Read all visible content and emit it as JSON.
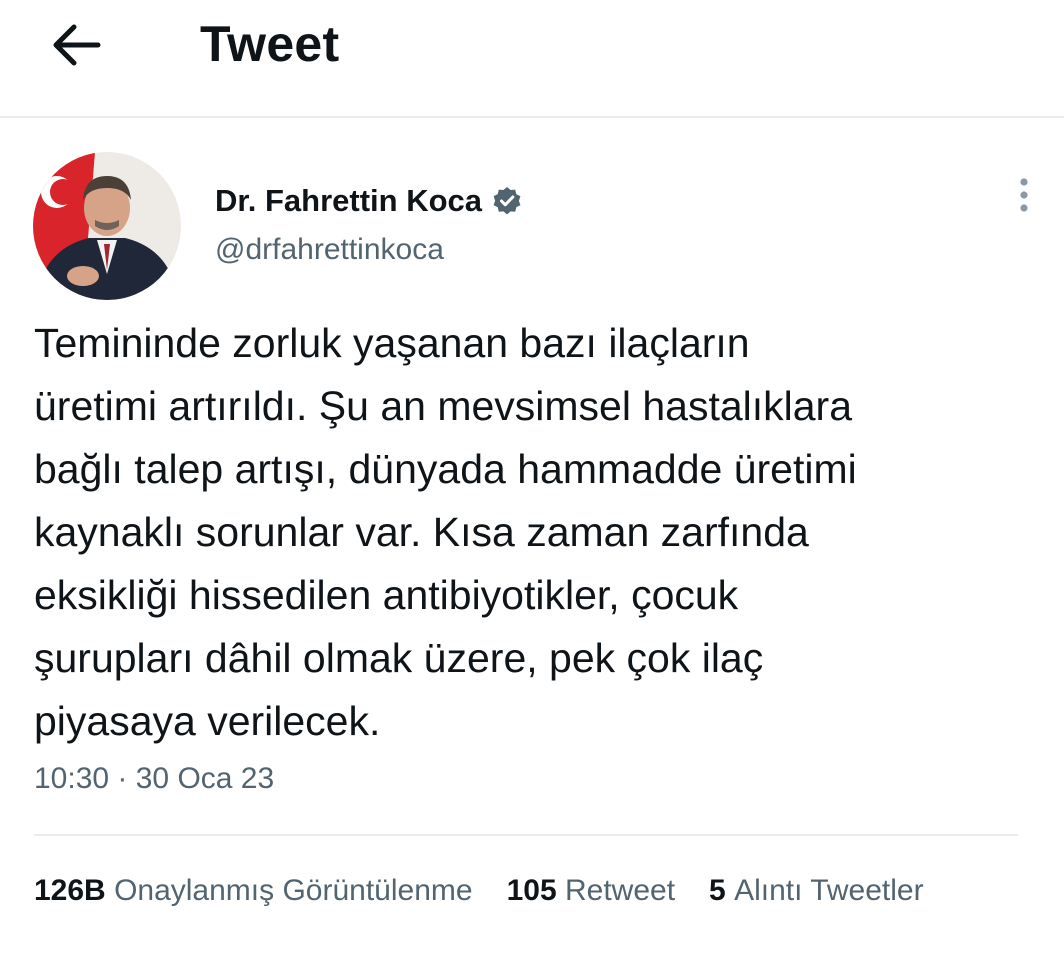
{
  "header": {
    "title": "Tweet",
    "back_icon": "arrow-left-icon"
  },
  "author": {
    "name": "Dr. Fahrettin Koca",
    "handle": "@drfahrettinkoca",
    "verified_icon": "verified-badge-icon",
    "verified_color": "#536471"
  },
  "tweet": {
    "text": "Temininde zorluk yaşanan bazı ilaçların\nüretimi artırıldı. Şu an mevsimsel hastalıklara\nbağlı talep artışı, dünyada hammadde üretimi\nkaynaklı sorunlar var. Kısa zaman zarfında\neksikliği hissedilen antibiyotikler, çocuk\nşurupları dâhil olmak üzere, pek çok ilaç\npiyasaya verilecek.",
    "timestamp": "10:30 · 30 Oca 23"
  },
  "stats": {
    "views_count": "126B",
    "views_label": "Onaylanmış Görüntülenme",
    "retweets_count": "105",
    "retweets_label": "Retweet",
    "quotes_count": "5",
    "quotes_label": "Alıntı Tweetler"
  },
  "colors": {
    "text_primary": "#0f1419",
    "text_secondary": "#536471",
    "divider": "#e6ecf0"
  }
}
